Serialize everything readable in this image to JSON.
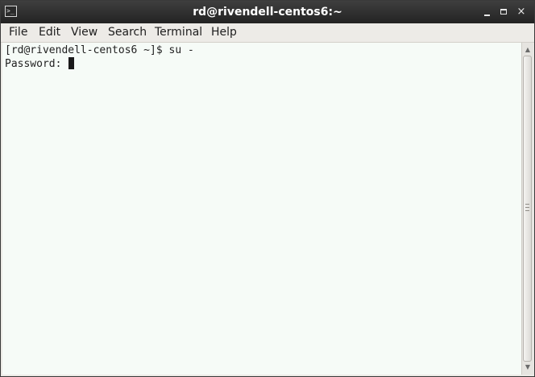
{
  "window": {
    "title": "rd@rivendell-centos6:~",
    "icon": "terminal-icon",
    "controls": {
      "minimize": "minimize-icon",
      "maximize": "maximize-icon",
      "close": "×"
    }
  },
  "menu": {
    "items": [
      {
        "label": "File"
      },
      {
        "label": "Edit"
      },
      {
        "label": "View"
      },
      {
        "label": "Search"
      },
      {
        "label": "Terminal"
      },
      {
        "label": "Help"
      }
    ]
  },
  "terminal": {
    "lines": [
      "[rd@rivendell-centos6 ~]$ su -",
      "Password: "
    ],
    "colors": {
      "background": "#f6fbf7",
      "foreground": "#222222"
    }
  },
  "scrollbar": {
    "up_icon": "▲",
    "down_icon": "▼"
  }
}
